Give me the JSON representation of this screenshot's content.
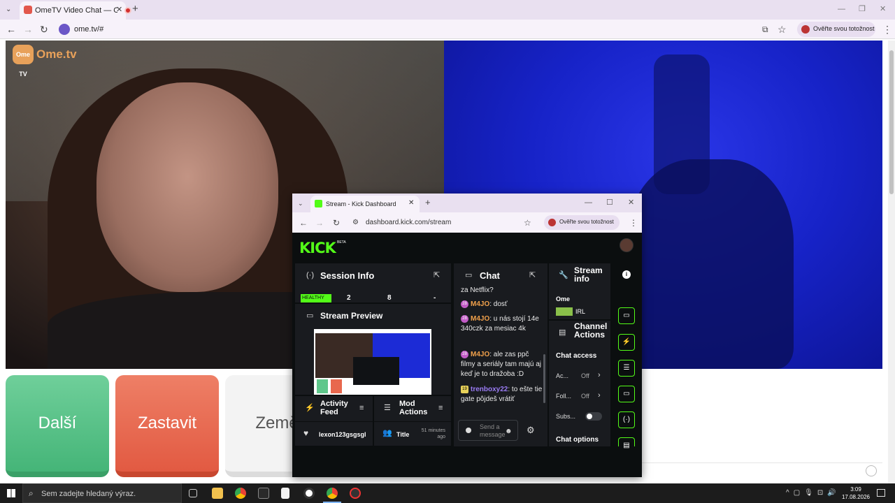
{
  "outer_browser": {
    "tab_title": "OmeTV Video Chat — Ome",
    "new_tab": "+",
    "url": "ome.tv/#",
    "profile_label": "Ověřte svou totožnost",
    "window_min": "—",
    "window_max": "❐",
    "window_close": "✕"
  },
  "ome": {
    "logo_badge": "Ome TV",
    "logo_text": "Ome.tv",
    "btn_next": "Další",
    "btn_stop": "Zastavit",
    "btn_country": "Země"
  },
  "kick_window": {
    "tab_title": "Stream - Kick Dashboard",
    "url": "dashboard.kick.com/stream",
    "profile_label": "Ověřte svou totožnost",
    "logo": "KICK",
    "logo_beta": "BETA",
    "session": {
      "title": "Session Info",
      "health": "HEALTHY",
      "stat1": "2",
      "stat2": "8",
      "stat3": "-"
    },
    "preview": {
      "title": "Stream Preview"
    },
    "activity": {
      "title": "Activity Feed",
      "item_user": "lexon123gsgsgl"
    },
    "mod": {
      "title": "Mod Actions",
      "item_label": "Title",
      "item_time": "51 minutes ago"
    },
    "chat": {
      "title": "Chat",
      "top_fragment": "za Netflix?",
      "messages": [
        {
          "badge": "28",
          "user": "M4JO",
          "text": ": dosť",
          "color": "#f0a04b"
        },
        {
          "badge": "28",
          "user": "M4JO",
          "text": ": u nás stojí 14e 340czk za mesiac 4k",
          "color": "#f0a04b"
        },
        {
          "badge": "28",
          "user": "M4JO",
          "text": ": ale zas ppč filmy a seriály tam majú aj keď je to dražoba :D",
          "color": "#f0a04b"
        },
        {
          "badge": "19",
          "user": "trenboxy22",
          "text": ": to ešte tie gate pôjdeš vrátiť",
          "color": "#9b7cf5"
        }
      ],
      "input_placeholder": "Send a message"
    },
    "stream_info": {
      "title": "Stream info",
      "stream_title": "Ome",
      "category": "IRL"
    },
    "channel": {
      "title": "Channel Actions",
      "chat_access": "Chat access",
      "row1_label": "Ac...",
      "row1_value": "Off",
      "row2_label": "Foll...",
      "row2_value": "Off",
      "row3_label": "Subs...",
      "chat_options": "Chat options"
    }
  },
  "taskbar": {
    "search_placeholder": "Sem zadejte hledaný výraz.",
    "time": "3:09",
    "date": "17.08.2026"
  }
}
